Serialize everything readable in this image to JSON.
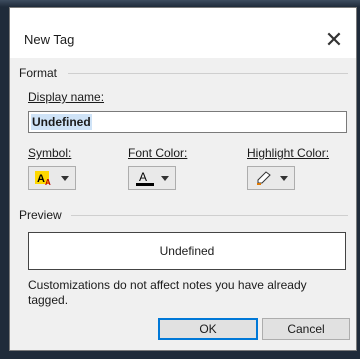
{
  "dialog": {
    "title": "New Tag",
    "close_glyph": "✕"
  },
  "format": {
    "group_label": "Format",
    "display_name_label": "Display name:",
    "display_name_value": "Undefined",
    "symbol_label": "Symbol:",
    "font_color_label": "Font Color:",
    "highlight_color_label": "Highlight Color:"
  },
  "icons": {
    "symbol": "symbol-icon",
    "font_color": "font-color-icon",
    "highlight": "highlight-pen-icon"
  },
  "preview": {
    "group_label": "Preview",
    "text": "Undefined"
  },
  "note": {
    "text": "Customizations do not affect notes you have already tagged."
  },
  "buttons": {
    "ok": "OK",
    "cancel": "Cancel"
  },
  "colors": {
    "accent": "#0078d7",
    "selection": "#cfe3f7",
    "font_color_bar": "#000000",
    "symbol_highlight": "#ffd800",
    "symbol_letter": "#c00000"
  }
}
